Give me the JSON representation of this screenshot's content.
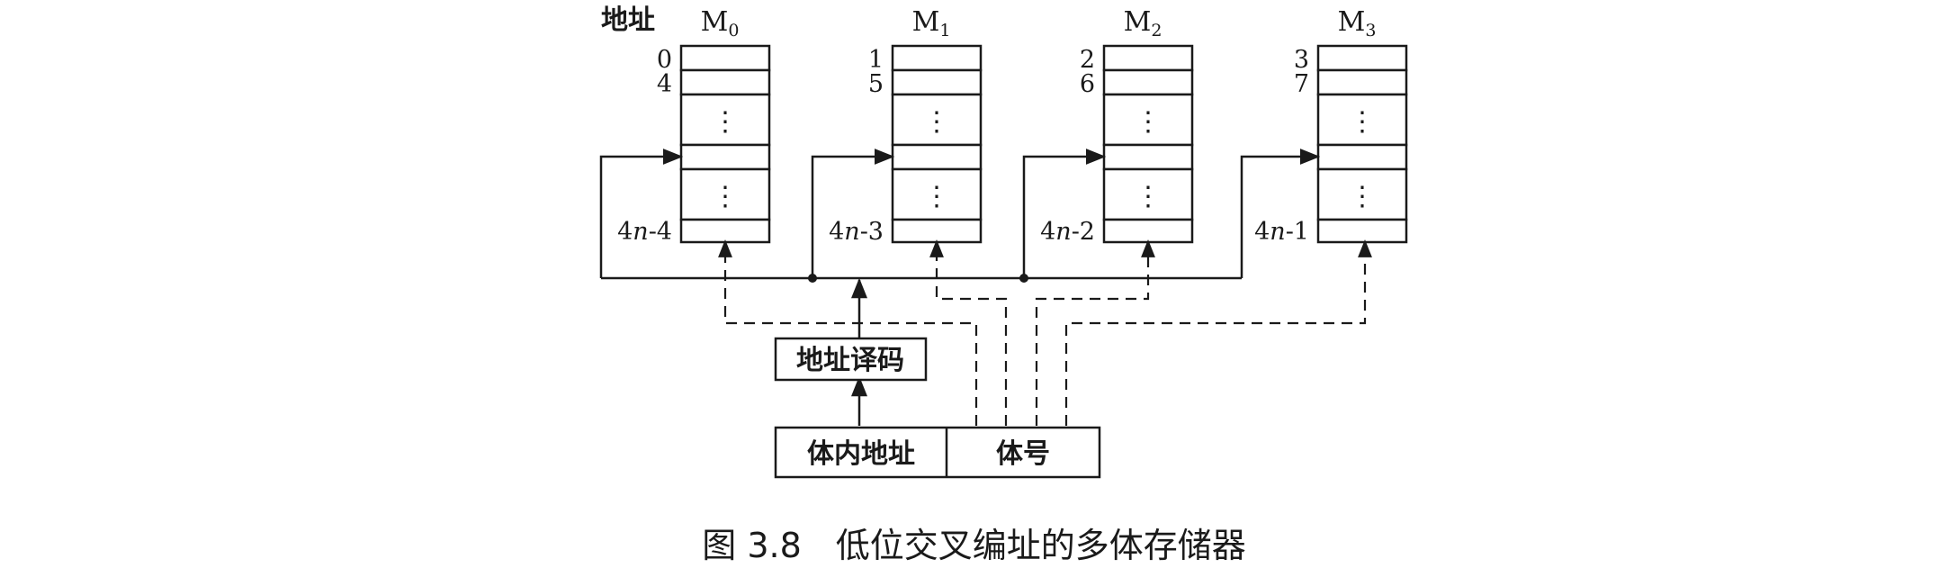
{
  "header_label": "地址",
  "modules": [
    {
      "id": "M",
      "sub": "0",
      "first": "0",
      "second": "4",
      "last": "4n-4",
      "last_num": "4",
      "last_off": "-4"
    },
    {
      "id": "M",
      "sub": "1",
      "first": "1",
      "second": "5",
      "last": "4n-3",
      "last_num": "4",
      "last_off": "-3"
    },
    {
      "id": "M",
      "sub": "2",
      "first": "2",
      "second": "6",
      "last": "4n-2",
      "last_num": "4",
      "last_off": "-2"
    },
    {
      "id": "M",
      "sub": "3",
      "first": "3",
      "second": "7",
      "last": "4n-1",
      "last_num": "4",
      "last_off": "-1"
    }
  ],
  "ellipsis": "⋮",
  "decoder_label": "地址译码",
  "inner_address_label": "体内地址",
  "bank_number_label": "体号",
  "caption": "图 3.8　低位交叉编址的多体存储器",
  "colors": {
    "ink": "#1a1a1a",
    "paper": "#ffffff"
  }
}
